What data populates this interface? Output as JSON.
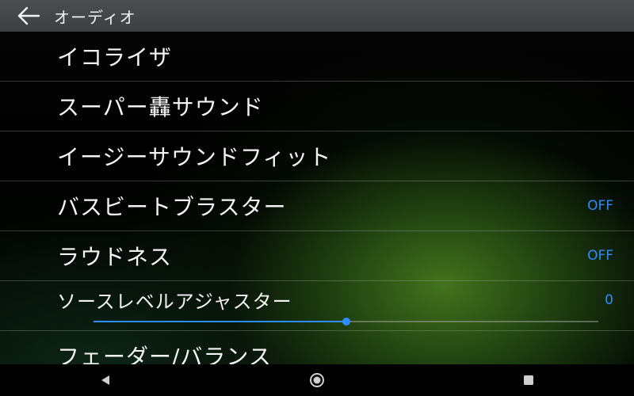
{
  "appbar": {
    "title": "オーディオ",
    "back_icon": "arrow-left-icon"
  },
  "items": [
    {
      "label": "イコライザ",
      "value": ""
    },
    {
      "label": "スーパー轟サウンド",
      "value": ""
    },
    {
      "label": "イージーサウンドフィット",
      "value": ""
    },
    {
      "label": "バスビートブラスター",
      "value": "OFF"
    },
    {
      "label": "ラウドネス",
      "value": "OFF"
    }
  ],
  "slider_item": {
    "label": "ソースレベルアジャスター",
    "value": "0",
    "level_fraction": 0.5
  },
  "partial_item": {
    "label": "フェーダー/バランス"
  },
  "navbar": {
    "back_icon": "triangle-back-icon",
    "home_icon": "circle-home-icon",
    "recents_icon": "square-recents-icon"
  },
  "colors": {
    "accent": "#2f8cff",
    "appbar": "#444848",
    "text": "#f4f4f4"
  }
}
